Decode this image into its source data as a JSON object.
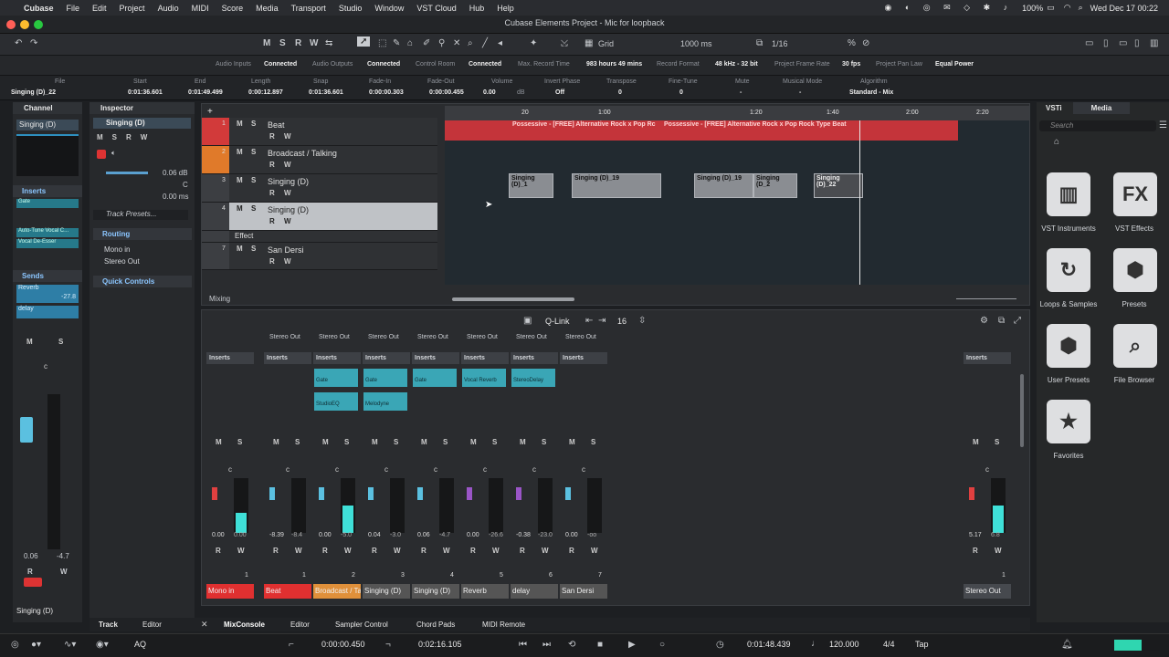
{
  "menubar": {
    "apple": "",
    "app": "Cubase",
    "items": [
      "File",
      "Edit",
      "Project",
      "Audio",
      "MIDI",
      "Score",
      "Media",
      "Transport",
      "Studio",
      "Window",
      "VST Cloud",
      "Hub",
      "Help"
    ],
    "battery": "100%",
    "datetime": "Wed Dec 17  00:22"
  },
  "window": {
    "title": "Cubase Elements Project - Mic for loopback"
  },
  "toolbar": {
    "mode_buttons": [
      "M",
      "S",
      "R",
      "W"
    ],
    "grid_type": "Grid",
    "grid_value": "1000 ms",
    "quantize": "1/16"
  },
  "connections": [
    {
      "label": "Audio Inputs",
      "value": "Connected"
    },
    {
      "label": "Audio Outputs",
      "value": "Connected"
    },
    {
      "label": "Control Room",
      "value": "Connected"
    },
    {
      "label": "Max. Record Time",
      "value": "983 hours 49 mins"
    },
    {
      "label": "Record Format",
      "value": "48 kHz - 32 bit"
    },
    {
      "label": "Project Frame Rate",
      "value": "30 fps"
    },
    {
      "label": "Project Pan Law",
      "value": "Equal Power"
    }
  ],
  "infoline": [
    {
      "label": "File",
      "value": "Singing (D)_22"
    },
    {
      "label": "Start",
      "value": "0:01:36.601"
    },
    {
      "label": "End",
      "value": "0:01:49.499"
    },
    {
      "label": "Length",
      "value": "0:00:12.897"
    },
    {
      "label": "Snap",
      "value": "0:01:36.601"
    },
    {
      "label": "Fade-In",
      "value": "0:00:00.303"
    },
    {
      "label": "Fade-Out",
      "value": "0:00:00.455"
    },
    {
      "label": "Volume",
      "value": "0.00"
    },
    {
      "label": "Invert Phase",
      "value": "Off"
    },
    {
      "label": "Transpose",
      "value": "0"
    },
    {
      "label": "Fine-Tune",
      "value": "0"
    },
    {
      "label": "Mute",
      "value": "-"
    },
    {
      "label": "Musical Mode",
      "value": "-"
    },
    {
      "label": "Algorithm",
      "value": "Standard - Mix"
    }
  ],
  "volume_unit": "dB",
  "channel_panel": {
    "tab": "Channel",
    "name": "Singing (D)",
    "inserts": "Inserts",
    "insert_items": [
      "Gate",
      "Auto-Tune Vocal C...",
      "Vocal De-Esser"
    ],
    "sends": "Sends",
    "send_items": [
      "Reverb",
      "delay"
    ],
    "send_value": "-27.8",
    "vol_left": "0.06",
    "vol_right": "-4.7",
    "footer": "Singing (D)"
  },
  "inspector": {
    "tab": "Inspector",
    "track": "Singing (D)",
    "volume": "0.06 dB",
    "pan": "C",
    "delay": "0.00 ms",
    "presets": "Track Presets...",
    "routing": "Routing",
    "input": "Mono in",
    "output": "Stereo Out",
    "quick_controls": "Quick Controls"
  },
  "tracks": [
    {
      "num": "1",
      "name": "Beat",
      "color": "#d23a3a"
    },
    {
      "num": "2",
      "name": "Broadcast / Talking",
      "color": "#e07a2a"
    },
    {
      "num": "3",
      "name": "Singing (D)",
      "color": "#3c3e42"
    },
    {
      "num": "4",
      "name": "Singing (D)",
      "color": "#3c3e42"
    },
    {
      "num": "",
      "name": "Effect",
      "color": "#3c3e42"
    },
    {
      "num": "7",
      "name": "San Dersi",
      "color": "#3c3e42"
    }
  ],
  "tracklist_footer": "Mixing",
  "ruler": [
    "20",
    "1:00",
    "1:20",
    "1:40",
    "2:00",
    "2:20"
  ],
  "clips": {
    "beat": [
      "Possessive - [FREE] Alternative Rock x Pop Rc",
      "Possessive - [FREE] Alternative Rock x Pop Rock Type Beat"
    ],
    "vocal": [
      "Singing (D)_1",
      "Singing (D)_19",
      "Singing (D)_19",
      "Singing (D_2",
      "Singing (D)_22"
    ]
  },
  "mixer": {
    "qlink": "Q-Link",
    "count": "16",
    "channels": [
      {
        "num": "1",
        "name": "Mono in",
        "out": "",
        "l": "0.00",
        "r": "0.00"
      },
      {
        "num": "1",
        "name": "Beat",
        "out": "Stereo Out",
        "l": "-8.39",
        "r": "-8.4"
      },
      {
        "num": "2",
        "name": "Broadcast / Talking",
        "out": "Stereo Out",
        "l": "0.00",
        "r": "-5.0"
      },
      {
        "num": "3",
        "name": "Singing (D)",
        "out": "Stereo Out",
        "l": "0.04",
        "r": "-3.0"
      },
      {
        "num": "4",
        "name": "Singing (D)",
        "out": "Stereo Out",
        "l": "0.06",
        "r": "-4.7"
      },
      {
        "num": "5",
        "name": "Reverb",
        "out": "Stereo Out",
        "l": "0.00",
        "r": "-26.6"
      },
      {
        "num": "6",
        "name": "delay",
        "out": "Stereo Out",
        "l": "-0.38",
        "r": "-23.0"
      },
      {
        "num": "7",
        "name": "San Dersi",
        "out": "Stereo Out",
        "l": "0.00",
        "r": "-oo"
      }
    ],
    "master": {
      "num": "1",
      "name": "Stereo Out",
      "l": "5.17",
      "r": "6.8"
    },
    "inserts_label": "Inserts",
    "plugins": [
      [
        "Gate",
        "StudioEQ"
      ],
      [
        "Gate",
        "Melodyne"
      ],
      [
        "Gate"
      ],
      [
        "Vocal Reverb"
      ],
      [
        "StereoDelay"
      ]
    ]
  },
  "media": {
    "tabs": [
      "VSTi",
      "Media"
    ],
    "search_placeholder": "Search",
    "tiles": [
      "VST Instruments",
      "VST Effects",
      "Loops & Samples",
      "Presets",
      "User Presets",
      "File Browser",
      "Favorites"
    ]
  },
  "bottomtabs": {
    "left": [
      "Track",
      "Editor"
    ],
    "right": [
      "MixConsole",
      "Editor",
      "Sampler Control",
      "Chord Pads",
      "MIDI Remote"
    ]
  },
  "transport": {
    "left_locator": "0:00:00.450",
    "right_locator": "0:02:16.105",
    "position": "0:01:48.439",
    "tempo": "120.000",
    "signature": "4/4",
    "tap": "Tap",
    "aq": "AQ"
  }
}
